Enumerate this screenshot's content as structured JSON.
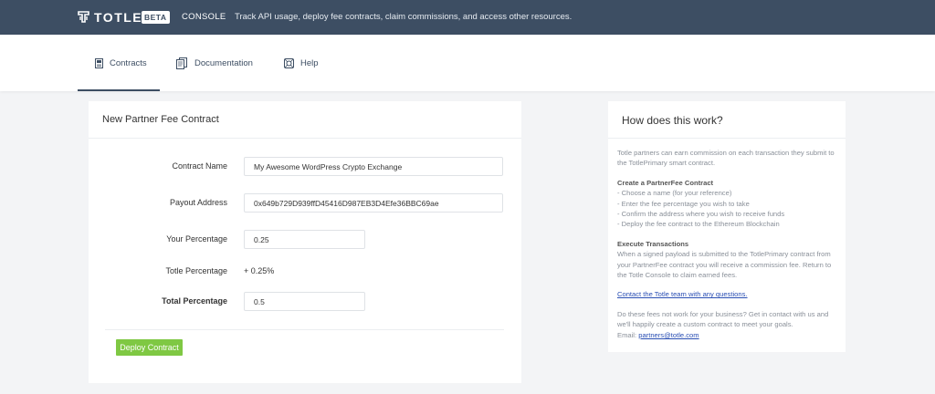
{
  "header": {
    "logo_text": "TOTLE",
    "badge": "BETA",
    "console": "CONSOLE",
    "tagline": "Track API usage, deploy fee contracts, claim commissions, and access other resources."
  },
  "nav": {
    "contracts": "Contracts",
    "documentation": "Documentation",
    "help": "Help"
  },
  "form": {
    "title": "New Partner Fee Contract",
    "contract_name_label": "Contract Name",
    "contract_name_value": "My Awesome WordPress Crypto Exchange",
    "payout_label": "Payout Address",
    "payout_value": "0x649b729D939ffD45416D987EB3D4Efe36BBC69ae",
    "your_pct_label": "Your Percentage",
    "your_pct_value": "0.25",
    "totle_pct_label": "Totle Percentage",
    "totle_pct_value": "+ 0.25%",
    "total_pct_label": "Total Percentage",
    "total_pct_value": "0.5",
    "deploy_button": "Deploy Contract"
  },
  "side": {
    "title": "How does this work?",
    "intro": "Totle partners can earn commission on each transaction they submit to the TotlePrimary smart contract.",
    "create_heading": "Create a PartnerFee Contract",
    "create_steps": [
      "- Choose a name (for your reference)",
      "- Enter the fee percentage you wish to take",
      "- Confirm the address where you wish to receive funds",
      "- Deploy the fee contract to the Ethereum Blockchain"
    ],
    "execute_heading": "Execute Transactions",
    "execute_text": "When a signed payload is submitted to the TotlePrimary contract from your PartnerFee contract you will receive a commission fee. Return to the Totle Console to claim earned fees.",
    "contact_link": "Contact the Totle team with any questions.",
    "custom_text": "Do these fees not work for your business? Get in contact with us and we'll happily create a custom contract to meet your goals.",
    "email_label": "Email:",
    "email_link": "partners@totle.com"
  },
  "colors": {
    "header_bg": "#3d4e63",
    "accent_green": "#7fc843",
    "link_blue": "#2a4fb4"
  }
}
